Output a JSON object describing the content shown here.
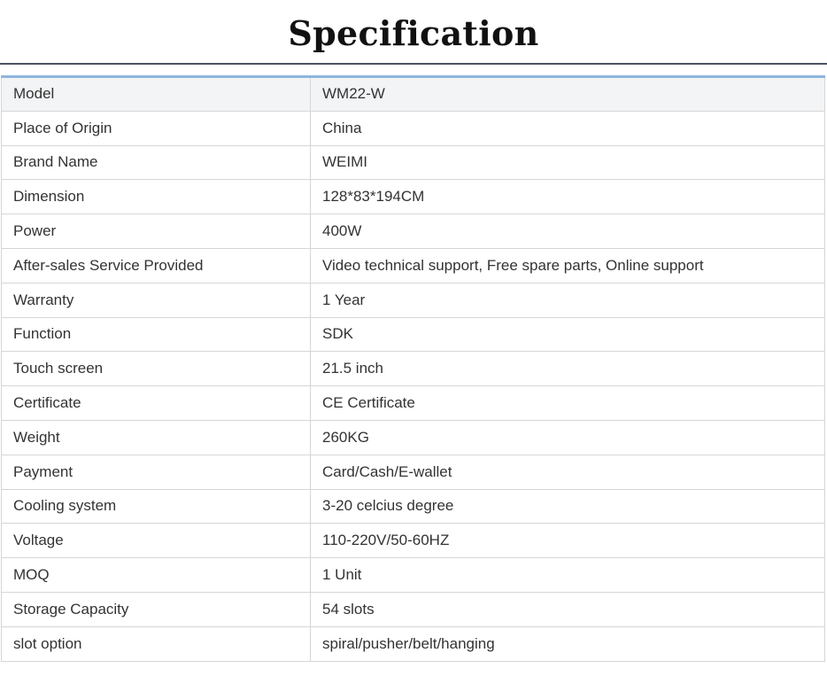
{
  "title": "Specification",
  "rows": [
    {
      "label": "Model",
      "value": "WM22-W"
    },
    {
      "label": "Place of Origin",
      "value": "China"
    },
    {
      "label": "Brand Name",
      "value": "WEIMI"
    },
    {
      "label": "Dimension",
      "value": "128*83*194CM"
    },
    {
      "label": "Power",
      "value": "400W"
    },
    {
      "label": "After-sales Service Provided",
      "value": "Video technical support, Free spare parts, Online support"
    },
    {
      "label": "Warranty",
      "value": "1 Year"
    },
    {
      "label": "Function",
      "value": "SDK"
    },
    {
      "label": "Touch screen",
      "value": "21.5 inch"
    },
    {
      "label": "Certificate",
      "value": "CE Certificate"
    },
    {
      "label": "Weight",
      "value": "260KG"
    },
    {
      "label": "Payment",
      "value": "Card/Cash/E-wallet"
    },
    {
      "label": "Cooling system",
      "value": "3-20 celcius degree"
    },
    {
      "label": "Voltage",
      "value": "110-220V/50-60HZ"
    },
    {
      "label": "MOQ",
      "value": "1 Unit"
    },
    {
      "label": "Storage Capacity",
      "value": "54 slots"
    },
    {
      "label": "slot option",
      "value": "spiral/pusher/belt/hanging"
    }
  ]
}
